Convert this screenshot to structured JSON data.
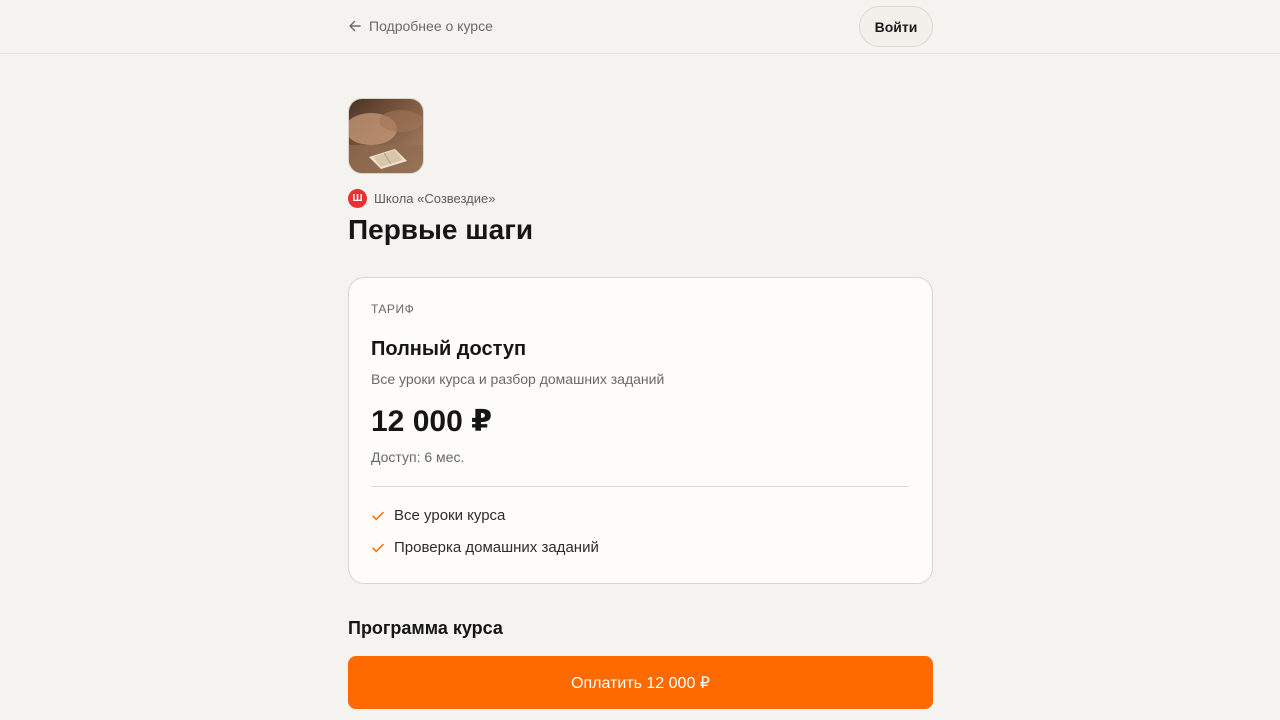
{
  "header": {
    "back_label": "Подробнее о курсе",
    "back_icon": "arrow-left-icon",
    "login_label": "Войти"
  },
  "course": {
    "school_logo_letter": "Ш",
    "school_name": "Школа «Созвездие»",
    "title": "Первые шаги"
  },
  "tariff": {
    "label": "ТАРИФ",
    "name": "Полный доступ",
    "description": "Все уроки курса и разбор домашних заданий",
    "price": "12 000 ₽",
    "access": "Доступ: 6 мес.",
    "features": [
      {
        "label": "Все уроки курса",
        "icon": "check-icon"
      },
      {
        "label": "Проверка домашних заданий",
        "icon": "check-icon"
      }
    ]
  },
  "program": {
    "title": "Программа курса"
  },
  "actions": {
    "pay_label": "Оплатить 12 000 ₽"
  },
  "colors": {
    "accent": "#ff6a00",
    "background": "#f4f3ef",
    "card": "#fdfcf8",
    "school_logo": "#e63232"
  }
}
